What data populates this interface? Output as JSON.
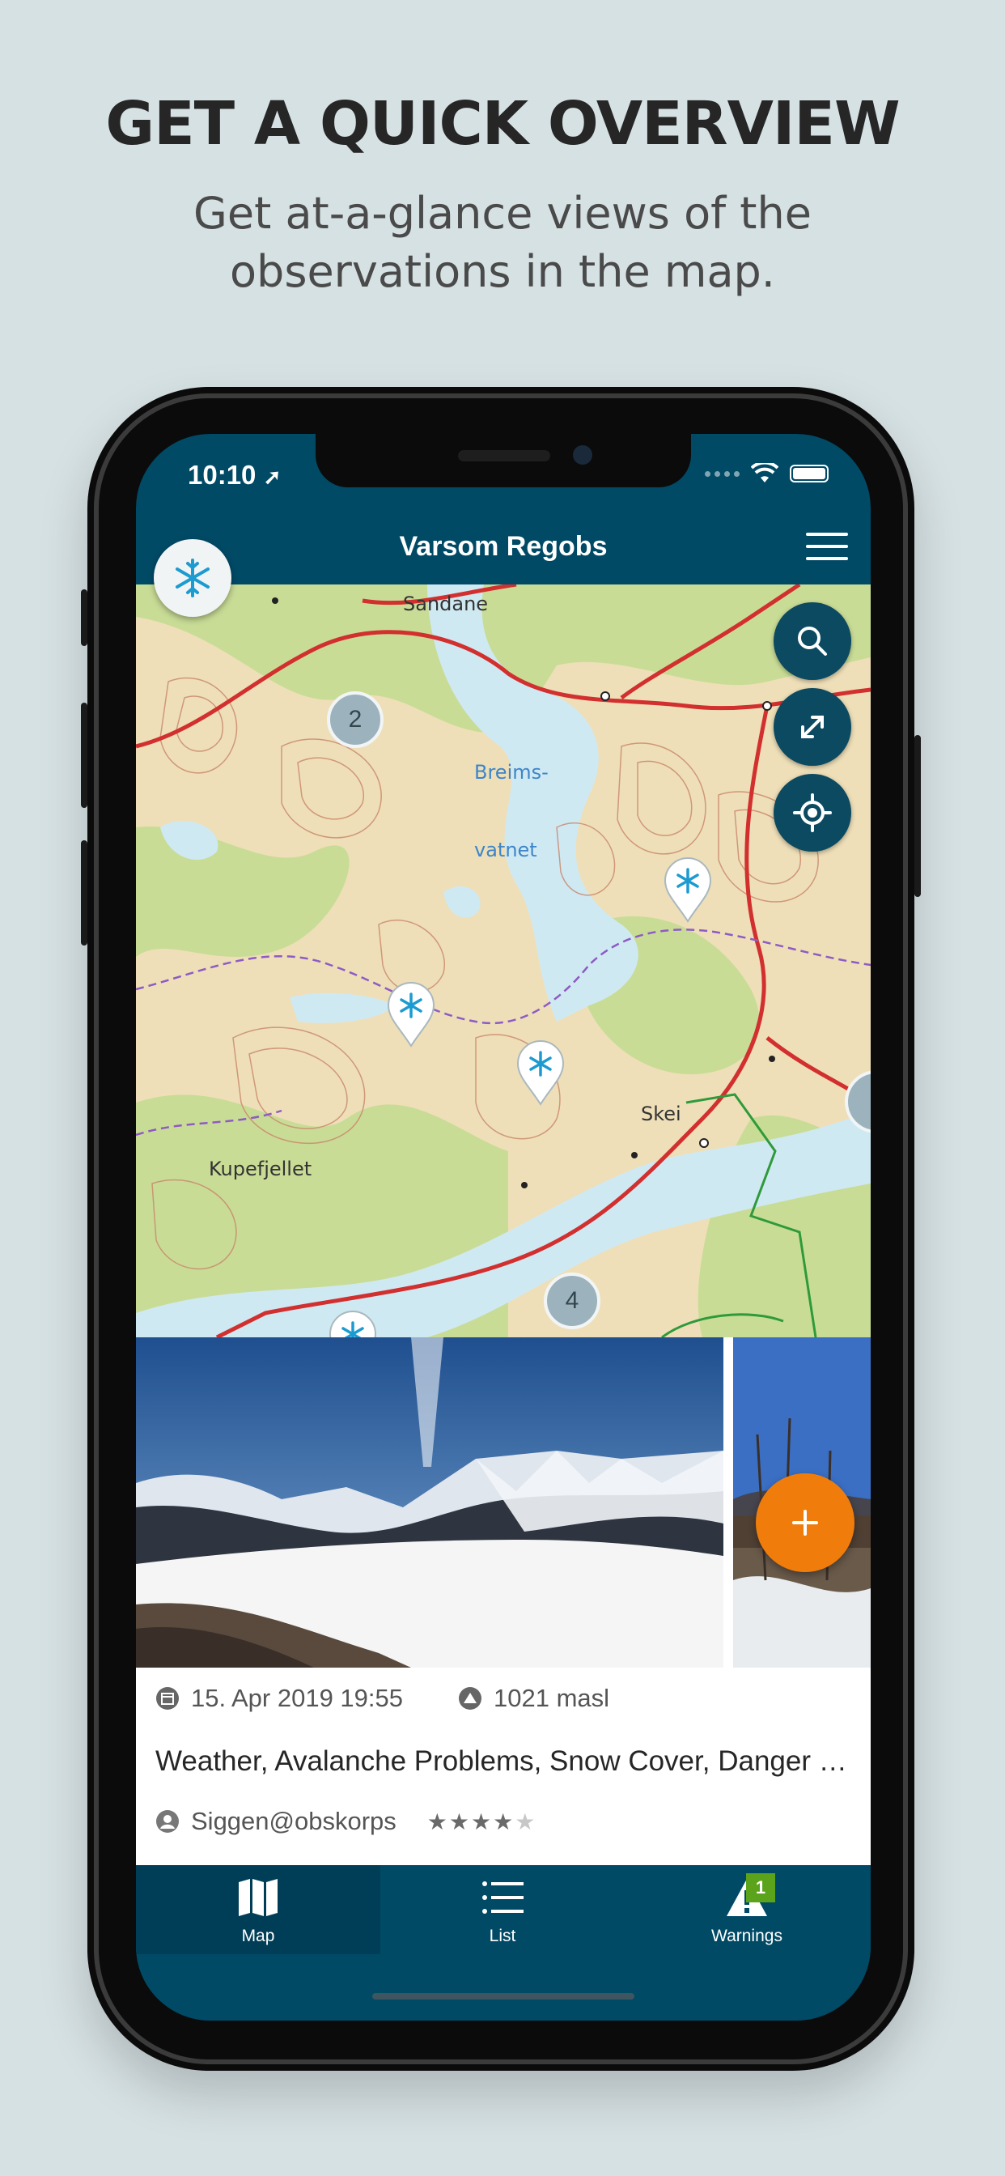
{
  "promo": {
    "headline": "GET A QUICK OVERVIEW",
    "subline_1": "Get at-a-glance views of the",
    "subline_2": "observations in the map."
  },
  "status_bar": {
    "time": "10:10"
  },
  "app": {
    "title": "Varsom Regobs"
  },
  "map": {
    "places": {
      "sandane": "Sandane",
      "breims": "Breims-",
      "vatnet": "vatnet",
      "skei": "Skei",
      "kupefjellet": "Kupefjellet"
    },
    "clusters": [
      {
        "count": "2"
      },
      {
        "count": "4"
      }
    ],
    "controls": [
      "search-icon",
      "expand-icon",
      "locate-icon"
    ],
    "colors": {
      "land": "#eedfb8",
      "forest": "#c9dc96",
      "water": "#cfe9f3",
      "road": "#d22f2f",
      "trail": "#8e5bc4",
      "contour": "#c8866a"
    }
  },
  "observation": {
    "date": "15. Apr 2019 19:55",
    "elevation": "1021 masl",
    "title": "Weather, Avalanche Problems, Snow Cover, Danger Signs",
    "author": "Siggen@obskorps",
    "rating": 4,
    "rating_max": 5
  },
  "tabs": [
    {
      "label": "Map",
      "icon": "map-icon",
      "active": true
    },
    {
      "label": "List",
      "icon": "list-icon",
      "active": false
    },
    {
      "label": "Warnings",
      "icon": "warning-icon",
      "active": false,
      "badge": "1"
    }
  ],
  "colors": {
    "primary": "#004a66",
    "accent": "#f07d0b",
    "badge": "#5aa31a",
    "background": "#d6e1e3"
  }
}
